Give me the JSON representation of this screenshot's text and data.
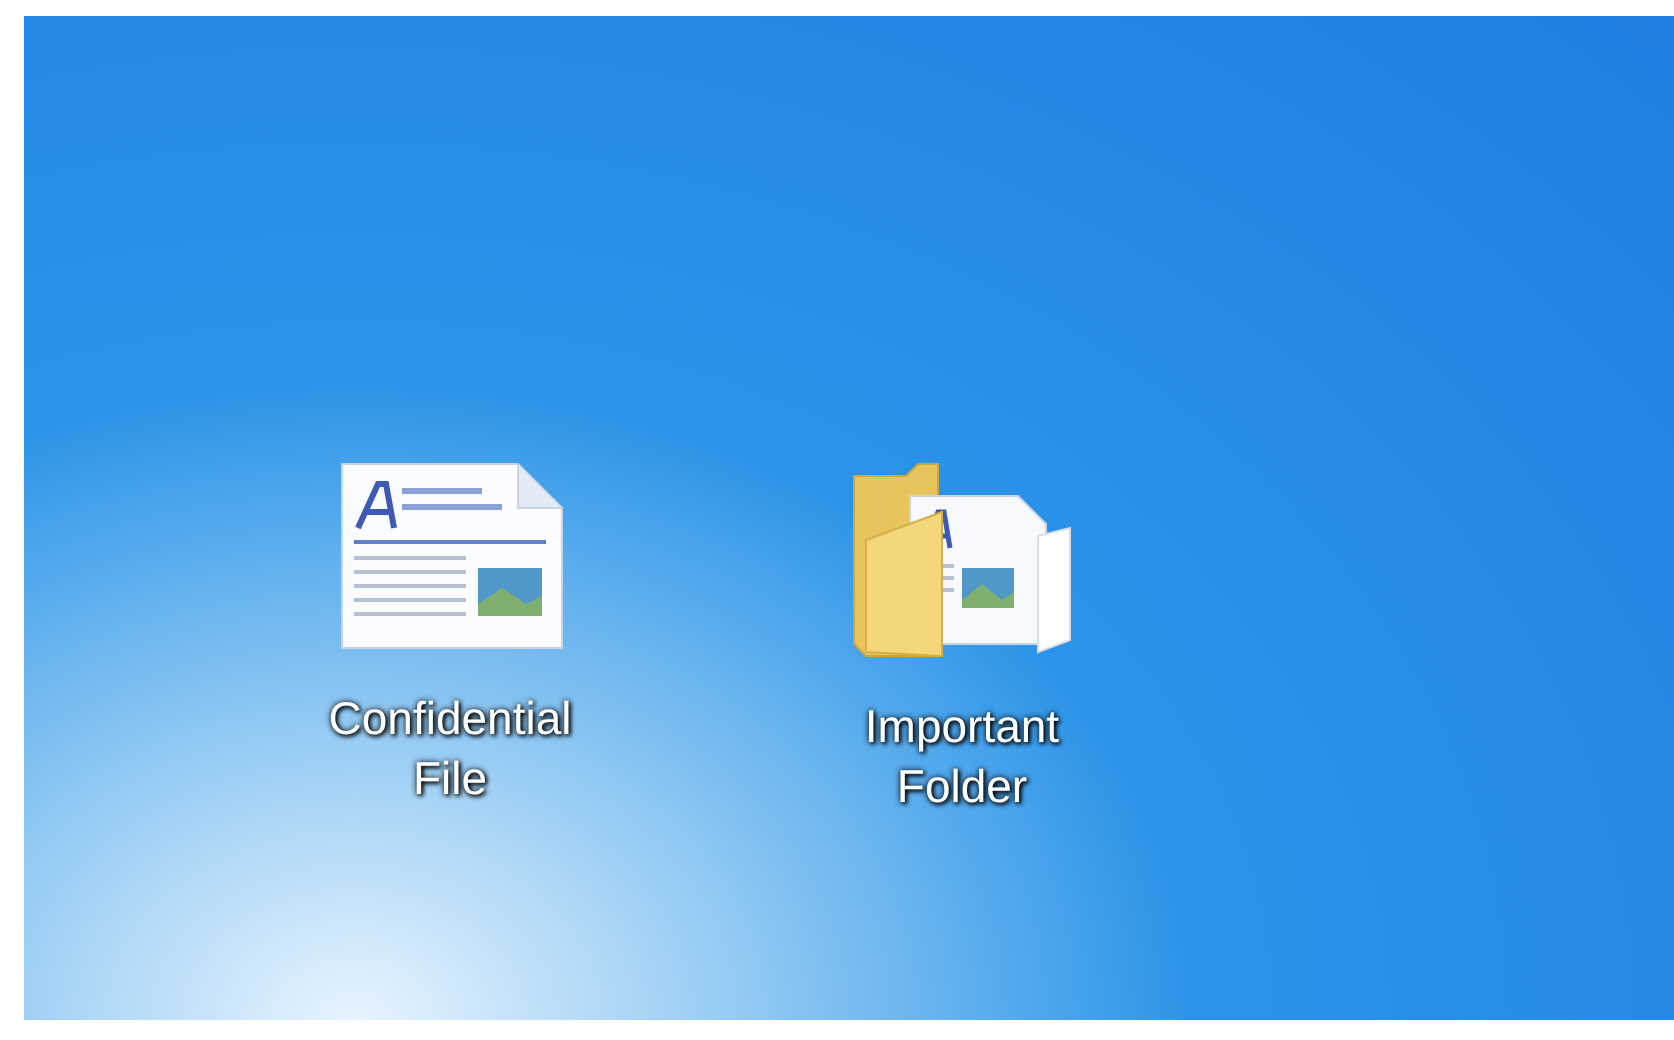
{
  "desktop": {
    "icons": [
      {
        "kind": "document",
        "label": "Confidential File"
      },
      {
        "kind": "folder",
        "label": "Important Folder"
      }
    ]
  }
}
